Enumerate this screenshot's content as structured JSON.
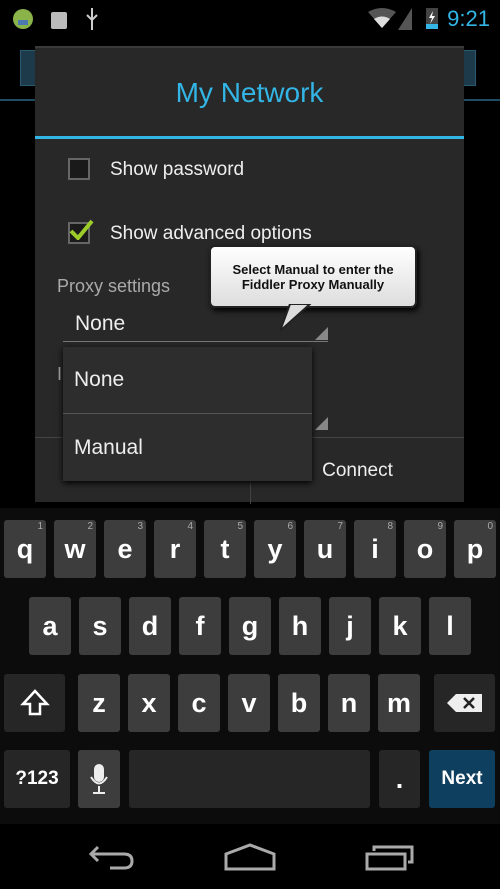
{
  "status_bar": {
    "time": "9:21",
    "icons": [
      "android-debug-icon",
      "android-icon",
      "usb-icon",
      "wifi-icon",
      "signal-icon",
      "battery-charging-icon"
    ]
  },
  "dialog": {
    "title": "My Network",
    "show_password": {
      "label": "Show password",
      "checked": false
    },
    "show_advanced": {
      "label": "Show advanced options",
      "checked": true
    },
    "proxy_label": "Proxy settings",
    "proxy_value": "None",
    "ip_label_partial": "I",
    "connect": "Connect"
  },
  "dropdown": {
    "options": [
      "None",
      "Manual"
    ]
  },
  "callout": {
    "line1": "Select Manual to enter the",
    "line2": "Fiddler Proxy Manually"
  },
  "keyboard": {
    "row1": [
      {
        "k": "q",
        "h": "1"
      },
      {
        "k": "w",
        "h": "2"
      },
      {
        "k": "e",
        "h": "3"
      },
      {
        "k": "r",
        "h": "4"
      },
      {
        "k": "t",
        "h": "5"
      },
      {
        "k": "y",
        "h": "6"
      },
      {
        "k": "u",
        "h": "7"
      },
      {
        "k": "i",
        "h": "8"
      },
      {
        "k": "o",
        "h": "9"
      },
      {
        "k": "p",
        "h": "0"
      }
    ],
    "row2": [
      "a",
      "s",
      "d",
      "f",
      "g",
      "h",
      "j",
      "k",
      "l"
    ],
    "row3": [
      "z",
      "x",
      "c",
      "v",
      "b",
      "n",
      "m"
    ],
    "symbols": "?123",
    "period": ".",
    "next": "Next",
    "next_color": "#0e3f5e"
  },
  "accent": "#33b5e5"
}
